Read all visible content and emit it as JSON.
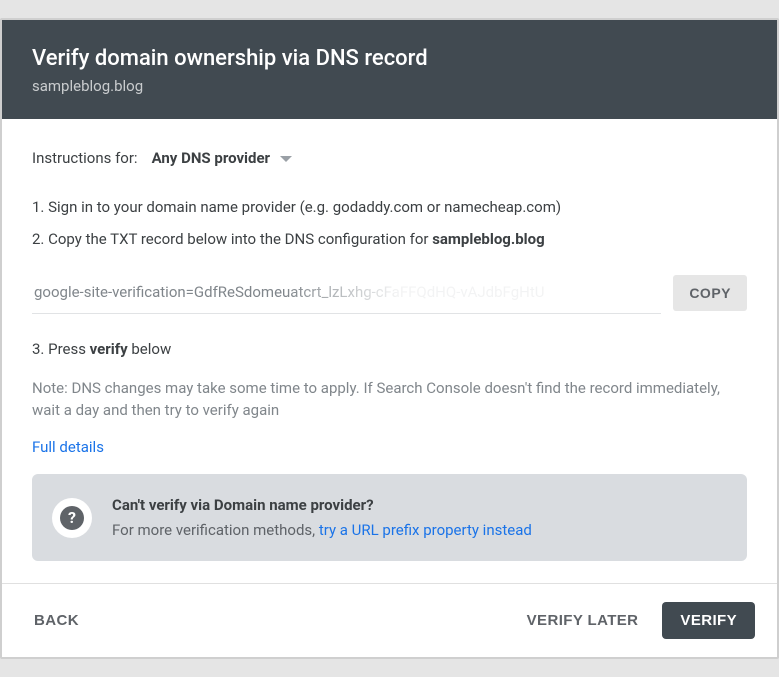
{
  "header": {
    "title": "Verify domain ownership via DNS record",
    "domain": "sampleblog.blog"
  },
  "provider": {
    "label": "Instructions for:",
    "selected": "Any DNS provider"
  },
  "steps": {
    "s1": "1. Sign in to your domain name provider (e.g. godaddy.com or namecheap.com)",
    "s2_prefix": "2. Copy the TXT record below into the DNS configuration for ",
    "s2_domain": "sampleblog.blog",
    "s3_prefix": "3. Press ",
    "s3_bold": "verify",
    "s3_suffix": " below"
  },
  "txt": {
    "value": "google-site-verification=GdfReSdomeuatcrt_lzLxhg-cFaFFQdHQ-vAJdbFgHtU",
    "copy_label": "COPY"
  },
  "note": "Note: DNS changes may take some time to apply. If Search Console doesn't find the record immediately, wait a day and then try to verify again",
  "full_details": "Full details",
  "callout": {
    "title": "Can't verify via Domain name provider?",
    "body_prefix": "For more verification methods, ",
    "link": "try a URL prefix property instead"
  },
  "footer": {
    "back": "BACK",
    "later": "VERIFY LATER",
    "verify": "VERIFY"
  }
}
